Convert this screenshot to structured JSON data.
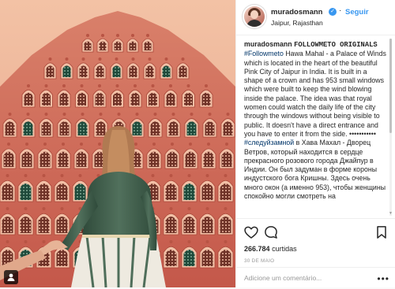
{
  "post": {
    "photo_alt": "",
    "author": {
      "username": "muradosmann",
      "verified": true,
      "follow_label": "Seguir",
      "location": "Jaipur, Rajasthan",
      "avatar_icon": "avatar"
    },
    "caption": {
      "username": "muradosmann",
      "title": "FOLLOWMETO ORIGINALS",
      "hashtag_en": "#Followmeto",
      "text_en": " Hawa Mahal - a Palace of Winds which is located in the heart of the beautiful Pink City of Jaipur in India. It is built in a shape of a crown and has 953 small windows which were built to keep the wind blowing inside the palace. The idea was that royal women could watch the daily life of the city through the windows without being visible to public. It doesn't have a direct entrance and you have to enter it from the side. ",
      "emoji_row": "•••••••••••",
      "hashtag_ru": "#следуйзамной",
      "text_ru": " в Хава Махал - Дворец Ветров, который находится в сердце прекрасного розового города Джайпур в Индии. Он был задуман в форме короны индустского бога Кришны. Здесь очень много окон (а именно 953), чтобы женщины спокойно могли смотреть на"
    },
    "actions": {
      "like_icon": "heart-outline",
      "comment_icon": "speech-bubble",
      "save_icon": "bookmark-outline"
    },
    "likes": {
      "count": "266.784",
      "label": "curtidas"
    },
    "date": "30 DE MAIO",
    "comment": {
      "placeholder": "Adicione um comentário...",
      "more_label": "•••"
    }
  },
  "colors": {
    "accent": "#3897f0",
    "palace_pink": "#d6735f",
    "text": "#262626",
    "muted": "#999999"
  }
}
